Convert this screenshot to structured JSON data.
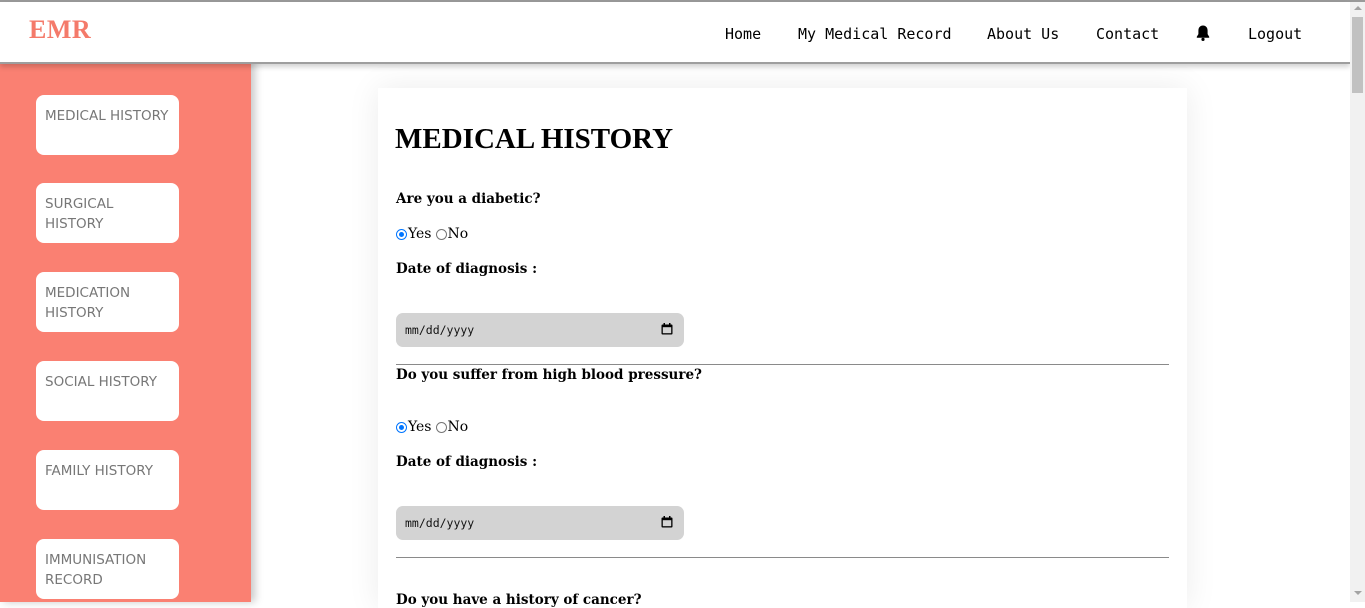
{
  "app": {
    "brand": "EMR",
    "brand_color": "#fa8072"
  },
  "nav": {
    "home": "Home",
    "my_record": "My Medical Record",
    "about": "About Us",
    "contact": "Contact",
    "bell_icon": "bell-icon",
    "logout": "Logout"
  },
  "sidebar": {
    "items": [
      {
        "label": "MEDICAL HISTORY"
      },
      {
        "label": "SURGICAL HISTORY"
      },
      {
        "label": "MEDICATION HISTORY"
      },
      {
        "label": "SOCIAL HISTORY"
      },
      {
        "label": "FAMILY HISTORY"
      },
      {
        "label": "IMMUNISATION RECORD"
      }
    ]
  },
  "main": {
    "title": "MEDICAL HISTORY",
    "questions": [
      {
        "question": "Are you a diabetic?",
        "yes_label": "Yes",
        "no_label": "No",
        "selected": "Yes",
        "date_label": "Date of diagnosis :",
        "date_placeholder": "mm/dd/yyyy"
      },
      {
        "question": "Do you suffer from high blood pressure?",
        "yes_label": "Yes",
        "no_label": "No",
        "selected": "Yes",
        "date_label": "Date of diagnosis :",
        "date_placeholder": "mm/dd/yyyy"
      },
      {
        "question": "Do you have a history of cancer?"
      }
    ]
  }
}
